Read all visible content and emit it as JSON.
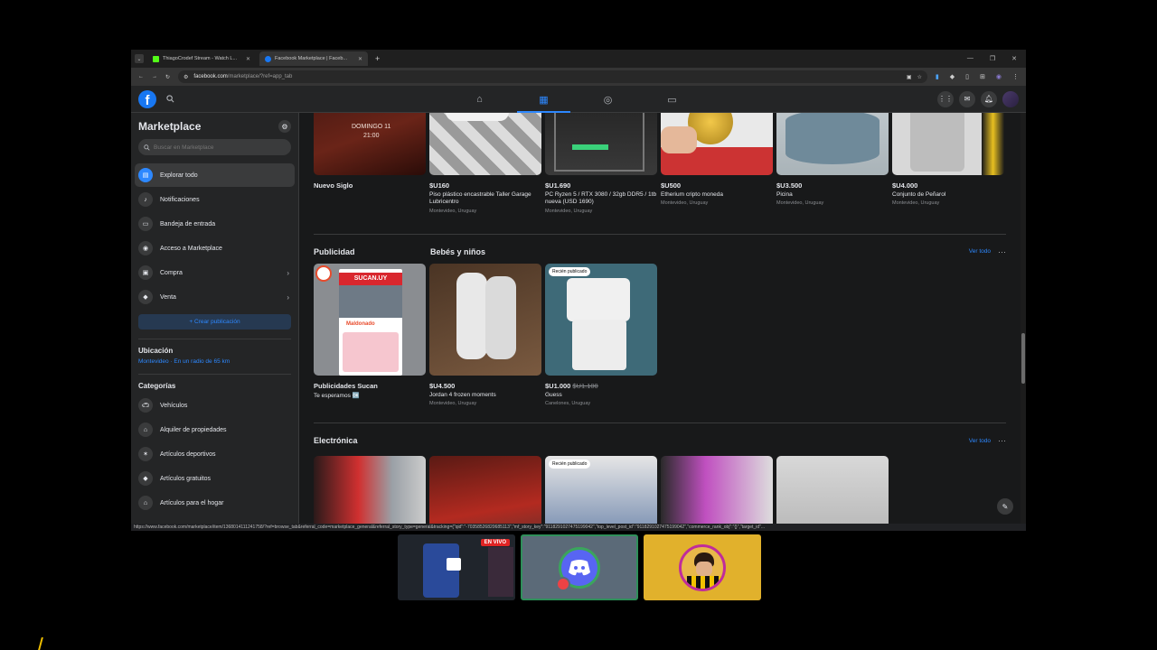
{
  "browser": {
    "tabs": [
      {
        "title": "ThiagoCrodef Stream - Watch L...",
        "favicon_color": "#53fc18",
        "active": false
      },
      {
        "title": "Facebook Marketplace | Faceb...",
        "favicon_color": "#1877f2",
        "active": true
      }
    ],
    "address": {
      "host": "facebook.com",
      "path": "/marketplace/?ref=app_tab"
    }
  },
  "fb": {
    "logo": "f"
  },
  "sidebar": {
    "title": "Marketplace",
    "search_placeholder": "Buscar en Marketplace",
    "items": [
      {
        "label": "Explorar todo",
        "icon": "storefront-icon",
        "active": true
      },
      {
        "label": "Notificaciones",
        "icon": "bell-icon"
      },
      {
        "label": "Bandeja de entrada",
        "icon": "inbox-icon"
      },
      {
        "label": "Acceso a Marketplace",
        "icon": "marketplace-access-icon"
      },
      {
        "label": "Compra",
        "icon": "bag-icon",
        "chevron": true
      },
      {
        "label": "Venta",
        "icon": "tag-icon",
        "chevron": true
      }
    ],
    "create_label": "+ Crear publicación",
    "location_heading": "Ubicación",
    "location_value": "Montevideo · En un radio de 65 km",
    "categories_heading": "Categorías",
    "categories": [
      {
        "label": "Vehículos",
        "icon": "car-icon"
      },
      {
        "label": "Alquiler de propiedades",
        "icon": "house-key-icon"
      },
      {
        "label": "Artículos deportivos",
        "icon": "runner-icon"
      },
      {
        "label": "Artículos gratuitos",
        "icon": "tag-icon"
      },
      {
        "label": "Artículos para el hogar",
        "icon": "home-icon"
      }
    ]
  },
  "feed": {
    "top_row": [
      {
        "price": "",
        "title": "Nuevo Siglo",
        "location": "",
        "img_text": "DOMINGO 11\n21:00"
      },
      {
        "price": "$U160",
        "title": "Piso plástico encastrable Taller Garage Lubricentro",
        "location": "Montevideo, Uruguay"
      },
      {
        "price": "$U1.690",
        "title": "PC Ryzen 5 / RTX 3080 / 32gb DDR5 / 1tb nueva (USD 1690)",
        "location": "Montevideo, Uruguay"
      },
      {
        "price": "$U500",
        "title": "Etherium cripto moneda",
        "location": "Montevideo, Uruguay"
      },
      {
        "price": "$U3.500",
        "title": "Picina",
        "location": "Montevideo, Uruguay"
      },
      {
        "price": "$U4.000",
        "title": "Conjunto de Peñarol",
        "location": "Montevideo, Uruguay"
      }
    ],
    "ads_heading": "Publicidad",
    "babies_heading": "Bebés y niños",
    "ver_todo": "Ver todo",
    "ad_card": {
      "title": "Publicidades Sucan",
      "subtitle": "Te esperamos 🆗",
      "img_text": "SUCAN.UY",
      "img_sub": "Maldonado"
    },
    "babies": [
      {
        "price": "$U4.500",
        "old_price": "",
        "title": "Jordan 4 frozen moments",
        "location": "Montevideo, Uruguay",
        "badge": ""
      },
      {
        "price": "$U1.000",
        "old_price": "$U1.100",
        "title": "Guess",
        "location": "Canelones, Uruguay",
        "badge": "Recién publicado"
      }
    ],
    "electronics_heading": "Electrónica",
    "electronics_badge": "Recién publicado"
  },
  "status_url": "https://www.facebook.com/marketplace/item/1368014111241758/?ref=browse_tab&referral_code=marketplace_general&referral_story_type=general&tracking={\"qid\":\"-70358526820685113\",\"mf_story_key\":\"9118291027475199042\",\"top_level_post_id\":\"9118291027475199042\",\"commerce_rank_obj\":\"{}\",\"target_id\"...",
  "overlay": {
    "live_label": "EN VIVO"
  },
  "colors": {
    "accent": "#2d88ff",
    "fb_blue": "#1877f2",
    "bg": "#18191a",
    "surface": "#242526"
  }
}
